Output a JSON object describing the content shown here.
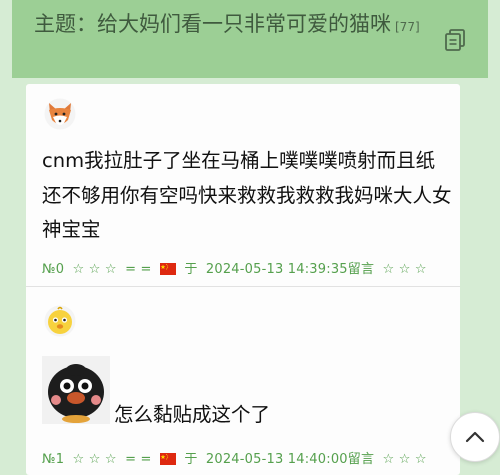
{
  "thread": {
    "title": "主题：给大妈们看一只非常可爱的猫咪",
    "reply_count": "[77]"
  },
  "posts": [
    {
      "avatar_icon": "fox-avatar-icon",
      "text": "cnm我拉肚子了坐在马桶上噗噗噗喷射而且纸还不够用你有空吗快来救救我救救我妈咪大人女神宝宝",
      "floor": "№0",
      "stars_left": "☆ ☆ ☆",
      "eq": "= =",
      "date_prefix": "于",
      "timestamp": "2024-05-13 14:39:35",
      "action": "留言",
      "stars_right": "☆ ☆ ☆"
    },
    {
      "avatar_icon": "chick-avatar-icon",
      "sticker_icon": "black-bird-sticker-icon",
      "text": "怎么黏贴成这个了",
      "floor": "№1",
      "stars_left": "☆ ☆ ☆",
      "eq": "= =",
      "date_prefix": "于",
      "timestamp": "2024-05-13 14:40:00",
      "action": "留言",
      "stars_right": "☆ ☆ ☆"
    }
  ],
  "colors": {
    "header_bg": "#9ccf95",
    "page_bg": "#d6ecd4",
    "meta_green": "#55a04d"
  },
  "scroll_top_icon": "chevron-up-icon"
}
